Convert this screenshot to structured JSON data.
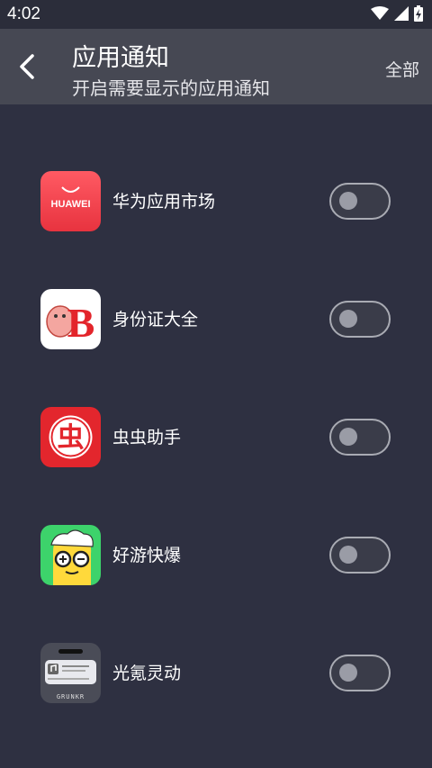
{
  "status_bar": {
    "time": "4:02"
  },
  "header": {
    "title": "应用通知",
    "subtitle": "开启需要显示的应用通知",
    "all_label": "全部"
  },
  "apps": [
    {
      "name": "华为应用市场",
      "icon": "huawei-appgallery-icon",
      "icon_text": "HUAWEI",
      "enabled": false
    },
    {
      "name": "身份证大全",
      "icon": "id-card-app-icon",
      "icon_text": "B",
      "enabled": false
    },
    {
      "name": "虫虫助手",
      "icon": "chongchong-icon",
      "icon_text": "虫",
      "enabled": false
    },
    {
      "name": "好游快爆",
      "icon": "haoyou-icon",
      "enabled": false
    },
    {
      "name": "光氪灵动",
      "icon": "guangke-icon",
      "icon_text": "GRUNKR",
      "enabled": false
    }
  ],
  "colors": {
    "background": "#2e3041",
    "app_bar": "#464853",
    "toggle_border": "#a9abb3",
    "toggle_knob": "#9a9ca6"
  }
}
